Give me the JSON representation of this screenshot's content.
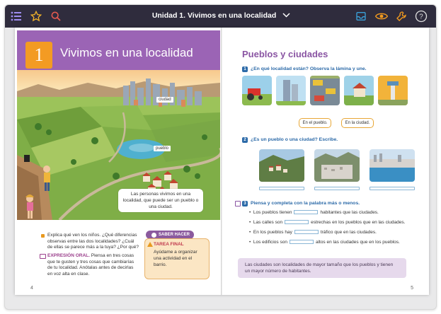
{
  "toolbar": {
    "title": "Unidad 1. Vivimos en una localidad",
    "icons": [
      "menu-icon",
      "star-icon",
      "search-icon",
      "chevron-down-icon",
      "tray-icon",
      "eye-icon",
      "wrench-icon",
      "help-icon"
    ],
    "help_label": "?"
  },
  "left_page": {
    "unit_number": "1",
    "unit_title": "Vivimos en una localidad",
    "tag_ciudad": "ciudad",
    "tag_pueblo": "pueblo",
    "caption": "Las personas vivimos en una localidad, que puede ser un pueblo o una ciudad.",
    "bullet1": "Explica qué ven los niños. ¿Qué diferencias observas entre las dos localidades? ¿Cuál de ellas se parece más a la tuya? ¿Por qué?",
    "expr_label": "EXPRESIÓN ORAL.",
    "bullet2": "Piensa en tres cosas que te gusten y tres cosas que cambiarías de tu localidad. Anótalas antes de decirlas en voz alta en clase.",
    "saber_hacer": "SABER HACER",
    "tarea_title": "TAREA FINAL",
    "tarea_text": "Ayúdame a organizar una actividad en el barrio.",
    "page_number": "4"
  },
  "right_page": {
    "section_title": "Pueblos y ciudades",
    "q1_num": "1",
    "q1": "¿En qué localidad están? Observa la lámina y une.",
    "pill1": "En el pueblo.",
    "pill2": "En la ciudad.",
    "q2_num": "2",
    "q2": "¿Es un pueblo o una ciudad? Escribe.",
    "q3_num": "3",
    "q3": "Piensa y completa con la palabra más o menos.",
    "fills": [
      {
        "before": "Los pueblos tienen",
        "after": "habitantes que las ciudades."
      },
      {
        "before": "Las calles son",
        "after": "estrechas en los pueblos que en las ciudades."
      },
      {
        "before": "En los pueblos hay",
        "after": "tráfico que en las ciudades."
      },
      {
        "before": "Los edificios son",
        "after": "altos en las ciudades que en los pueblos."
      }
    ],
    "summary": "Las ciudades son localidades de mayor tamaño que los pueblos y tienen un mayor número de habitantes.",
    "page_number": "5"
  },
  "colors": {
    "topbar": "#2f2c3d",
    "accent_purple": "#9b64b5",
    "accent_orange": "#f39b23",
    "question_blue": "#2c6aa8"
  }
}
